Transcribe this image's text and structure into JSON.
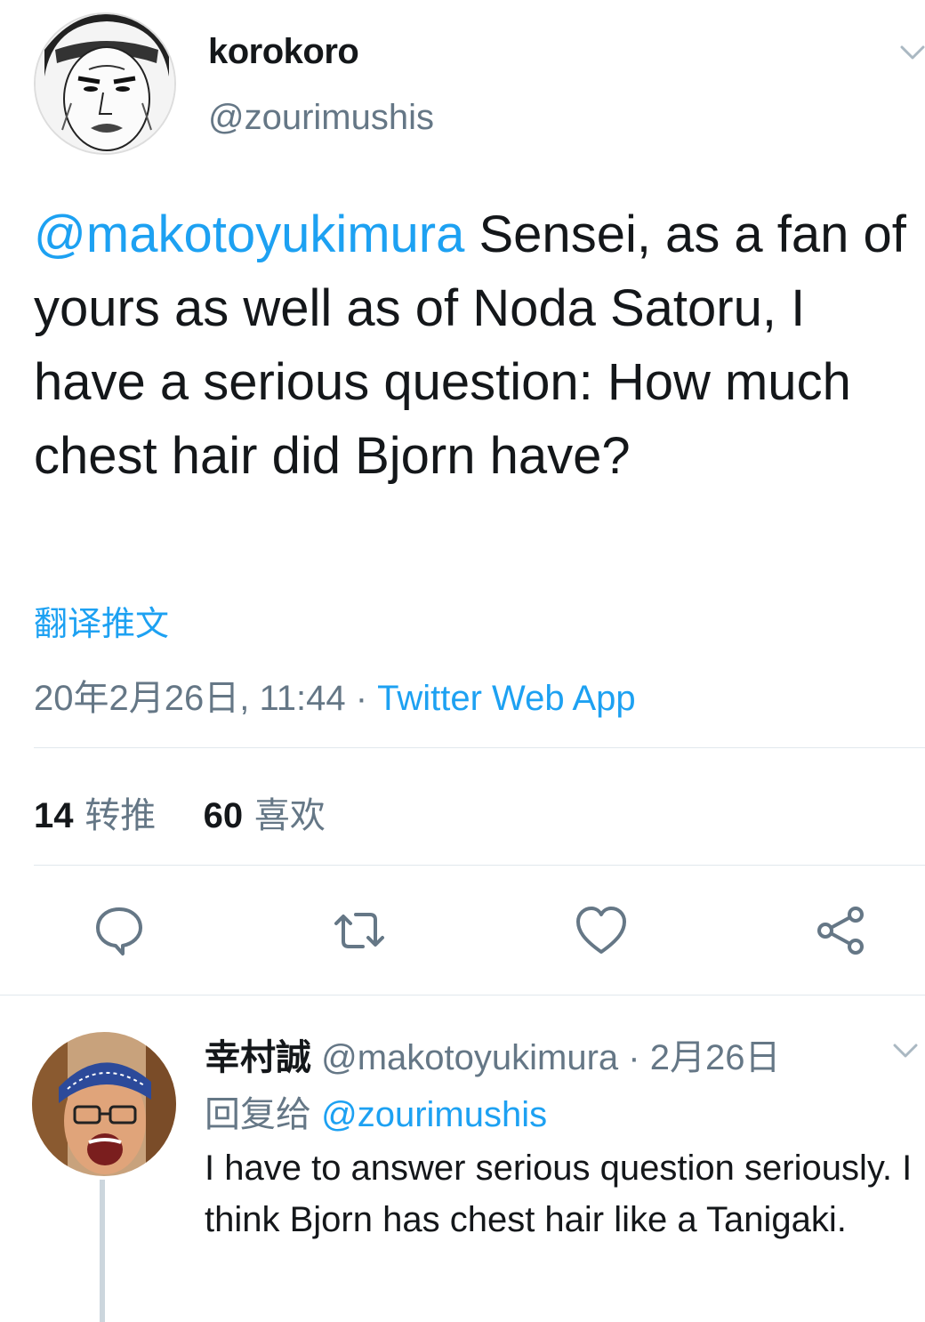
{
  "tweet": {
    "display_name": "korokoro",
    "handle": "@zourimushis",
    "mention": "@makotoyukimura",
    "text": " Sensei, as a fan of yours as well as of Noda Satoru, I have a serious question: How much chest hair did Bjorn have?",
    "translate_label": "翻译推文",
    "timestamp": "20年2月26日, 11:44",
    "separator": " · ",
    "source": "Twitter Web App",
    "retweet_count": "14",
    "retweet_label": "转推",
    "like_count": "60",
    "like_label": "喜欢"
  },
  "actions": [
    "reply-icon",
    "retweet-icon",
    "like-icon",
    "share-icon"
  ],
  "reply": {
    "display_name": "幸村誠",
    "handle": "@makotoyukimura",
    "date": " · 2月26日",
    "replying_label": "回复给",
    "replying_to": "@zourimushis",
    "text": "I have to answer serious question seriously. I think Bjorn has chest hair like a Tanigaki."
  },
  "colors": {
    "accent": "#1da1f2",
    "secondary_text": "#657786",
    "primary_text": "#14171a",
    "divider": "#e1e8ed"
  }
}
